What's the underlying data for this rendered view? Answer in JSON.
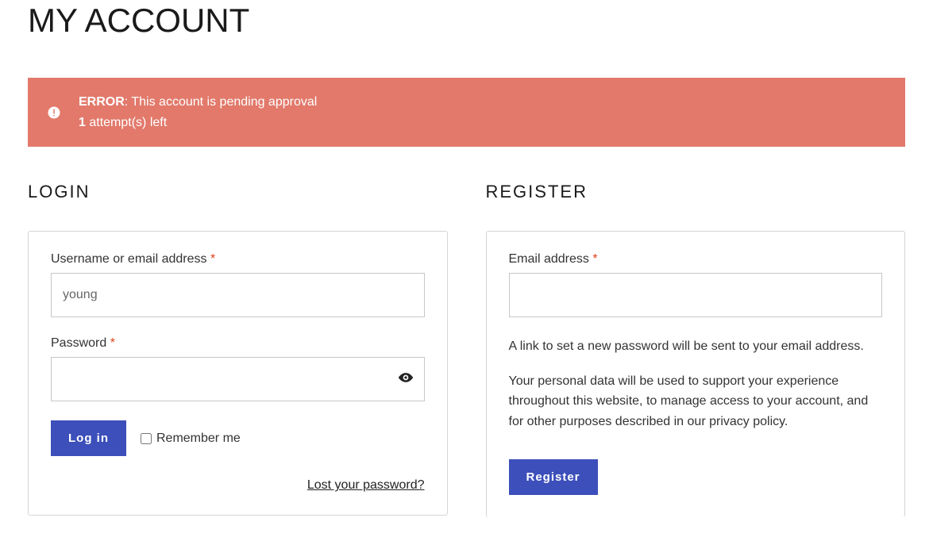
{
  "page_title": "MY ACCOUNT",
  "error": {
    "label": "ERROR",
    "message": ": This account is pending approval",
    "attempts_count": "1",
    "attempts_text": " attempt(s) left"
  },
  "login": {
    "heading": "LOGIN",
    "username_label": "Username or email address ",
    "username_value": "young",
    "password_label": "Password ",
    "submit_label": "Log in",
    "remember_label": "Remember me",
    "lost_password_label": "Lost your password?"
  },
  "register": {
    "heading": "REGISTER",
    "email_label": "Email address ",
    "email_value": "",
    "info_1": "A link to set a new password will be sent to your email address.",
    "info_2": "Your personal data will be used to support your experience throughout this website, to manage access to your account, and for other purposes described in our privacy policy.",
    "submit_label": "Register"
  },
  "required_marker": "*"
}
